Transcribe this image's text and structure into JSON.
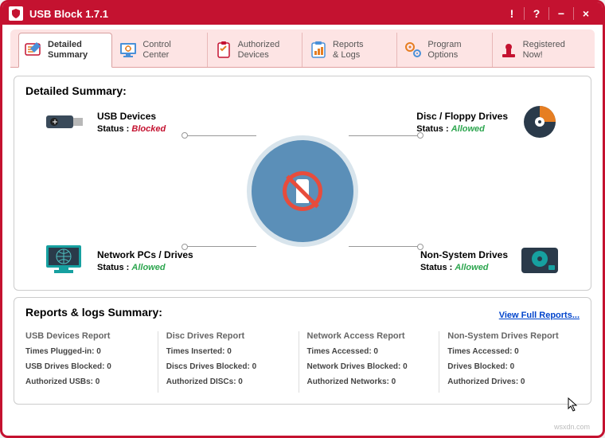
{
  "title": "USB Block 1.7.1",
  "titlebar_buttons": {
    "alert": "!",
    "help": "?",
    "minimize": "−",
    "close": "×"
  },
  "tabs": [
    {
      "line1": "Detailed",
      "line2": "Summary"
    },
    {
      "line1": "Control",
      "line2": "Center"
    },
    {
      "line1": "Authorized",
      "line2": "Devices"
    },
    {
      "line1": "Reports",
      "line2": "& Logs"
    },
    {
      "line1": "Program",
      "line2": "Options"
    },
    {
      "line1": "Registered",
      "line2": "Now!"
    }
  ],
  "summary_title": "Detailed Summary:",
  "status_label": "Status :",
  "devices": {
    "usb": {
      "name": "USB Devices",
      "status": "Blocked",
      "cls": "blocked"
    },
    "disc": {
      "name": "Disc / Floppy Drives",
      "status": "Allowed",
      "cls": "allowed"
    },
    "network": {
      "name": "Network PCs / Drives",
      "status": "Allowed",
      "cls": "allowed"
    },
    "nonsystem": {
      "name": "Non-System Drives",
      "status": "Allowed",
      "cls": "allowed"
    }
  },
  "reports_title": "Reports & logs Summary:",
  "view_full": "View Full Reports...",
  "reports": [
    {
      "title": "USB Devices Report",
      "r1": "Times Plugged-in: 0",
      "r2": "USB Drives Blocked: 0",
      "r3": "Authorized USBs: 0"
    },
    {
      "title": "Disc Drives Report",
      "r1": "Times Inserted: 0",
      "r2": "Discs Drives Blocked: 0",
      "r3": "Authorized DISCs: 0"
    },
    {
      "title": "Network Access Report",
      "r1": "Times Accessed: 0",
      "r2": "Network Drives Blocked: 0",
      "r3": "Authorized Networks: 0"
    },
    {
      "title": "Non-System Drives Report",
      "r1": "Times Accessed: 0",
      "r2": "Drives Blocked: 0",
      "r3": "Authorized Drives: 0"
    }
  ],
  "watermark": "wsxdn.com"
}
